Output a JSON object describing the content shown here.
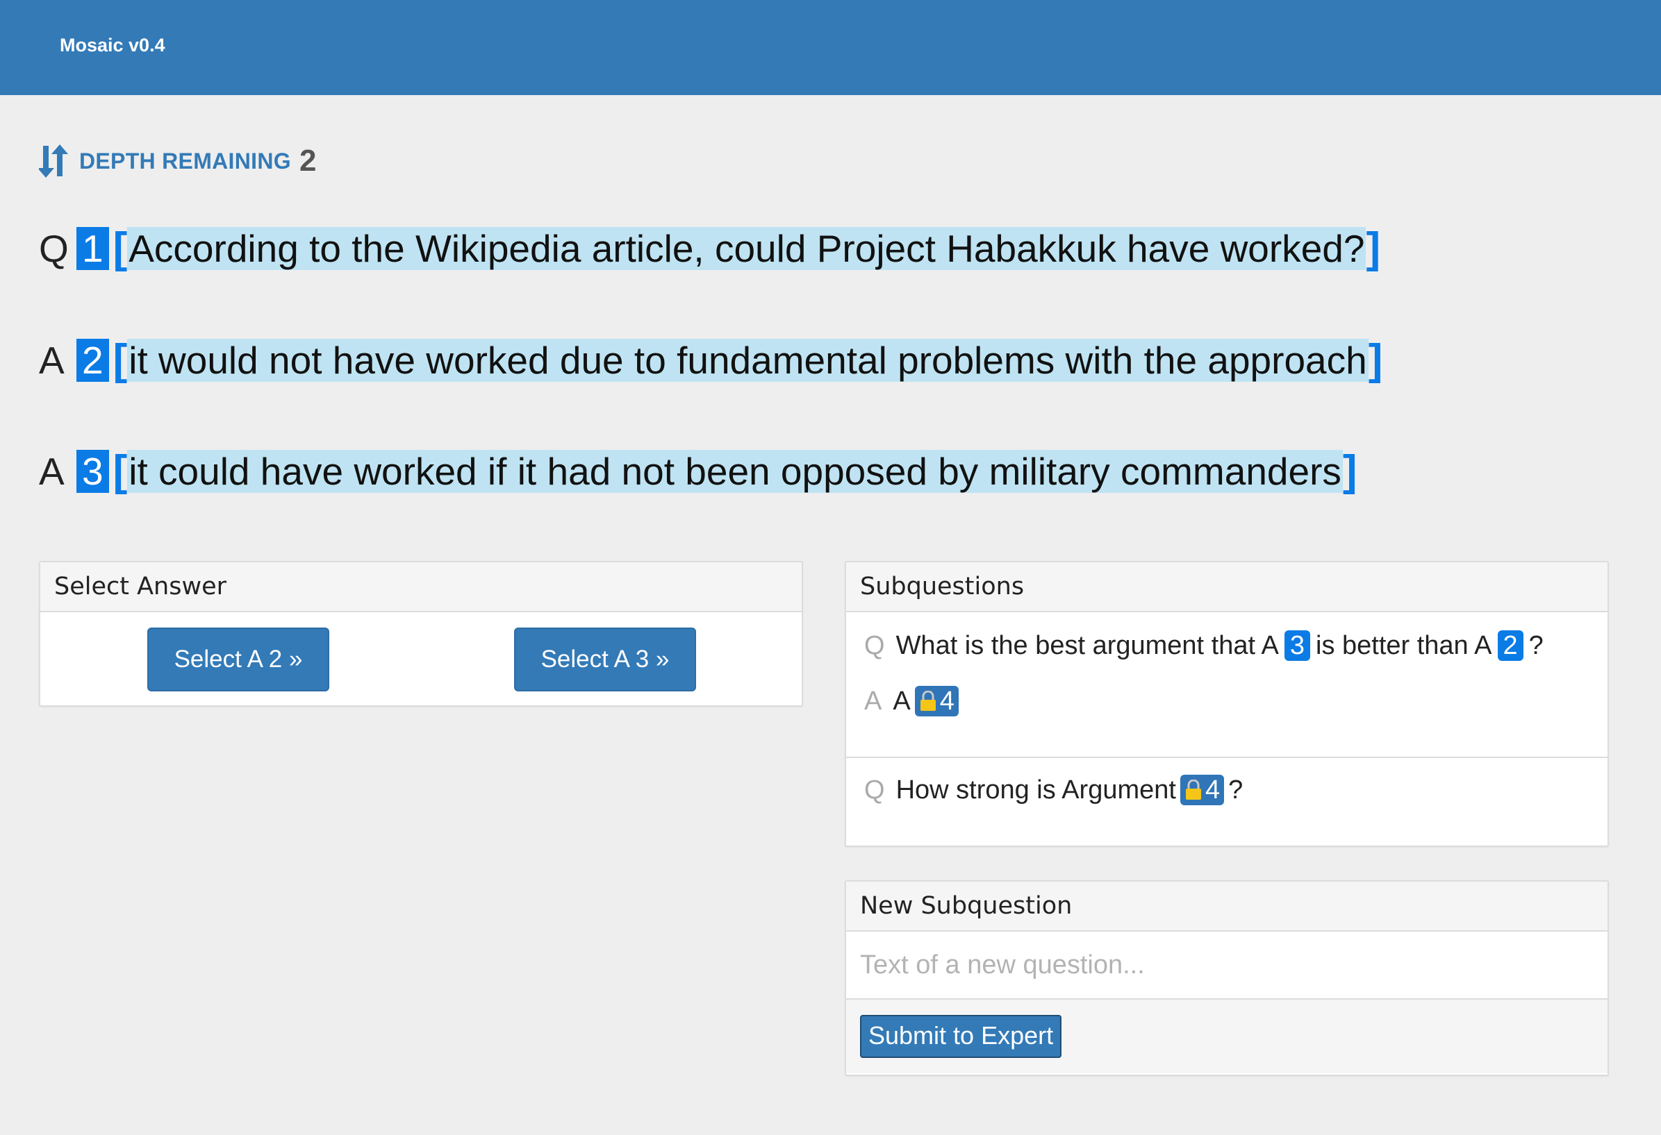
{
  "app": {
    "title": "Mosaic v0.4"
  },
  "depth": {
    "label": "DEPTH REMAINING",
    "value": "2"
  },
  "question": {
    "prefix": "Q",
    "pointer": "1",
    "text": "According to the Wikipedia article, could Project Habakkuk have worked?"
  },
  "answers": [
    {
      "prefix": "A",
      "pointer": "2",
      "text": "it would not have worked due to fundamental problems with the approach"
    },
    {
      "prefix": "A",
      "pointer": "3",
      "text": "it could have worked if it had not been opposed by military commanders "
    }
  ],
  "select_answer": {
    "title": "Select Answer",
    "buttons": [
      "Select A 2 »",
      "Select A 3 »"
    ]
  },
  "subquestions": {
    "title": "Subquestions",
    "items": [
      {
        "q_marker": "Q",
        "q_parts": [
          "What is the best argument that A",
          "3",
          "is better than A",
          "2",
          "?"
        ],
        "a_marker": "A",
        "a_text": "A",
        "a_locked_pointer": "4"
      },
      {
        "q_marker": "Q",
        "q_parts": [
          "How strong is Argument",
          "4",
          "?"
        ]
      }
    ]
  },
  "new_subquestion": {
    "title": "New Subquestion",
    "placeholder": "Text of a new question...",
    "submit_label": "Submit to Expert"
  },
  "colors": {
    "navbar": "#337ab7",
    "pointer": "#0b7be6",
    "highlight": "#bfe3f2",
    "background": "#eeeeee"
  }
}
